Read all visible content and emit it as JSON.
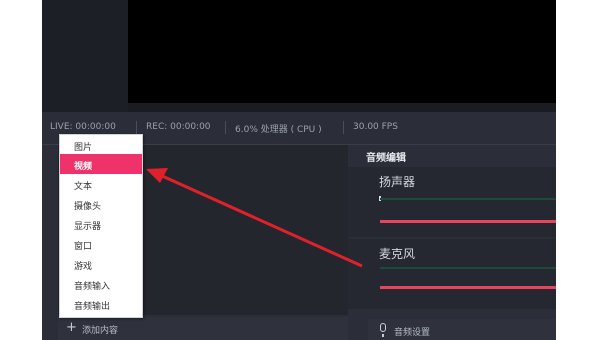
{
  "status": {
    "live": "LIVE: 00:00:00",
    "rec": "REC: 00:00:00",
    "cpu": "6.0% 处理器 ( CPU )",
    "fps": "30.00 FPS"
  },
  "context_menu": {
    "items": [
      "图片",
      "视频",
      "文本",
      "摄像头",
      "显示器",
      "窗口",
      "游戏",
      "音频输入",
      "音频输出"
    ],
    "selected": "视频"
  },
  "scene_panel": {
    "add_label": "添加内容"
  },
  "audio_panel": {
    "title": "音频编辑",
    "channels": [
      {
        "name": "扬声器"
      },
      {
        "name": "麦克风"
      }
    ],
    "settings_label": "音频设置"
  },
  "colors": {
    "accent": "#f0326a",
    "arrow": "#e0202a",
    "volume_bar": "#e8455c",
    "meter": "#1d4a3a"
  }
}
